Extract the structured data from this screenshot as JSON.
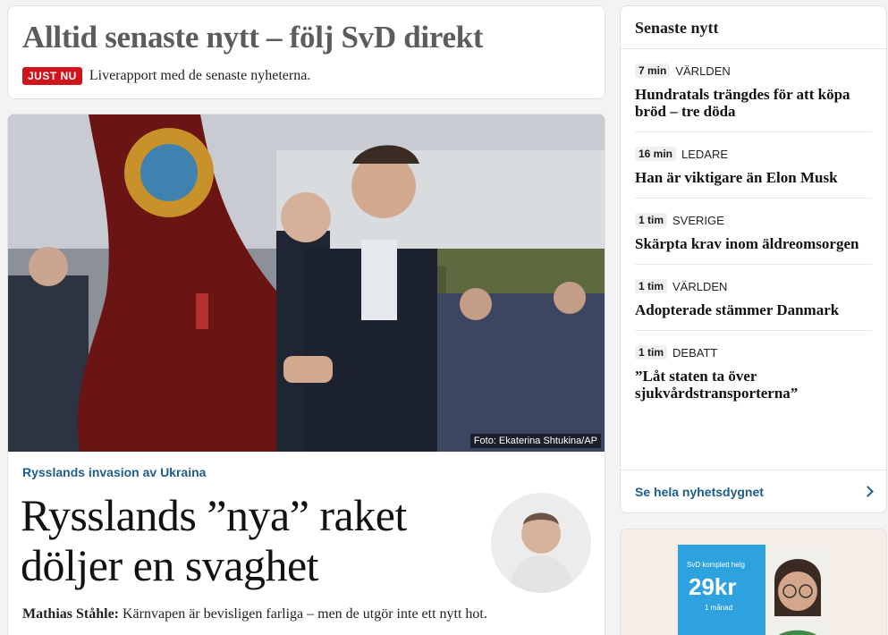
{
  "live": {
    "title": "Alltid senaste nytt – följ SvD direkt",
    "badge": "JUST NU",
    "subtitle": "Liverapport med de senaste nyheterna."
  },
  "article": {
    "photo_credit": "Foto: Ekaterina Shtukina/AP",
    "kicker": "Rysslands invasion av Ukraina",
    "headline": "Rysslands ”nya” raket döljer en svaghet",
    "author": "Mathias Ståhle:",
    "lead": " Kärnvapen är bevisligen farliga – men de utgör inte ett nytt hot."
  },
  "latest": {
    "heading": "Senaste nytt",
    "items": [
      {
        "time": "7 min",
        "section": "VÄRLDEN",
        "title": "Hundratals trängdes för att köpa bröd – tre döda"
      },
      {
        "time": "16 min",
        "section": "LEDARE",
        "title": "Han är viktigare än Elon Musk"
      },
      {
        "time": "1 tim",
        "section": "SVERIGE",
        "title": "Skärpta krav inom äldreomsorgen"
      },
      {
        "time": "1 tim",
        "section": "VÄRLDEN",
        "title": "Adopterade stämmer Danmark"
      },
      {
        "time": "1 tim",
        "section": "DEBATT",
        "title": "”Låt staten ta över sjukvårdstransporterna”"
      }
    ],
    "see_all": "Se hela nyhetsdygnet"
  },
  "ad": {
    "small": "SvD komplett helg",
    "price": "29kr",
    "sub": "1 månad"
  },
  "colors": {
    "badge": "#d0141c",
    "link": "#1e5c8c",
    "ad_blue": "#2ea1df"
  }
}
